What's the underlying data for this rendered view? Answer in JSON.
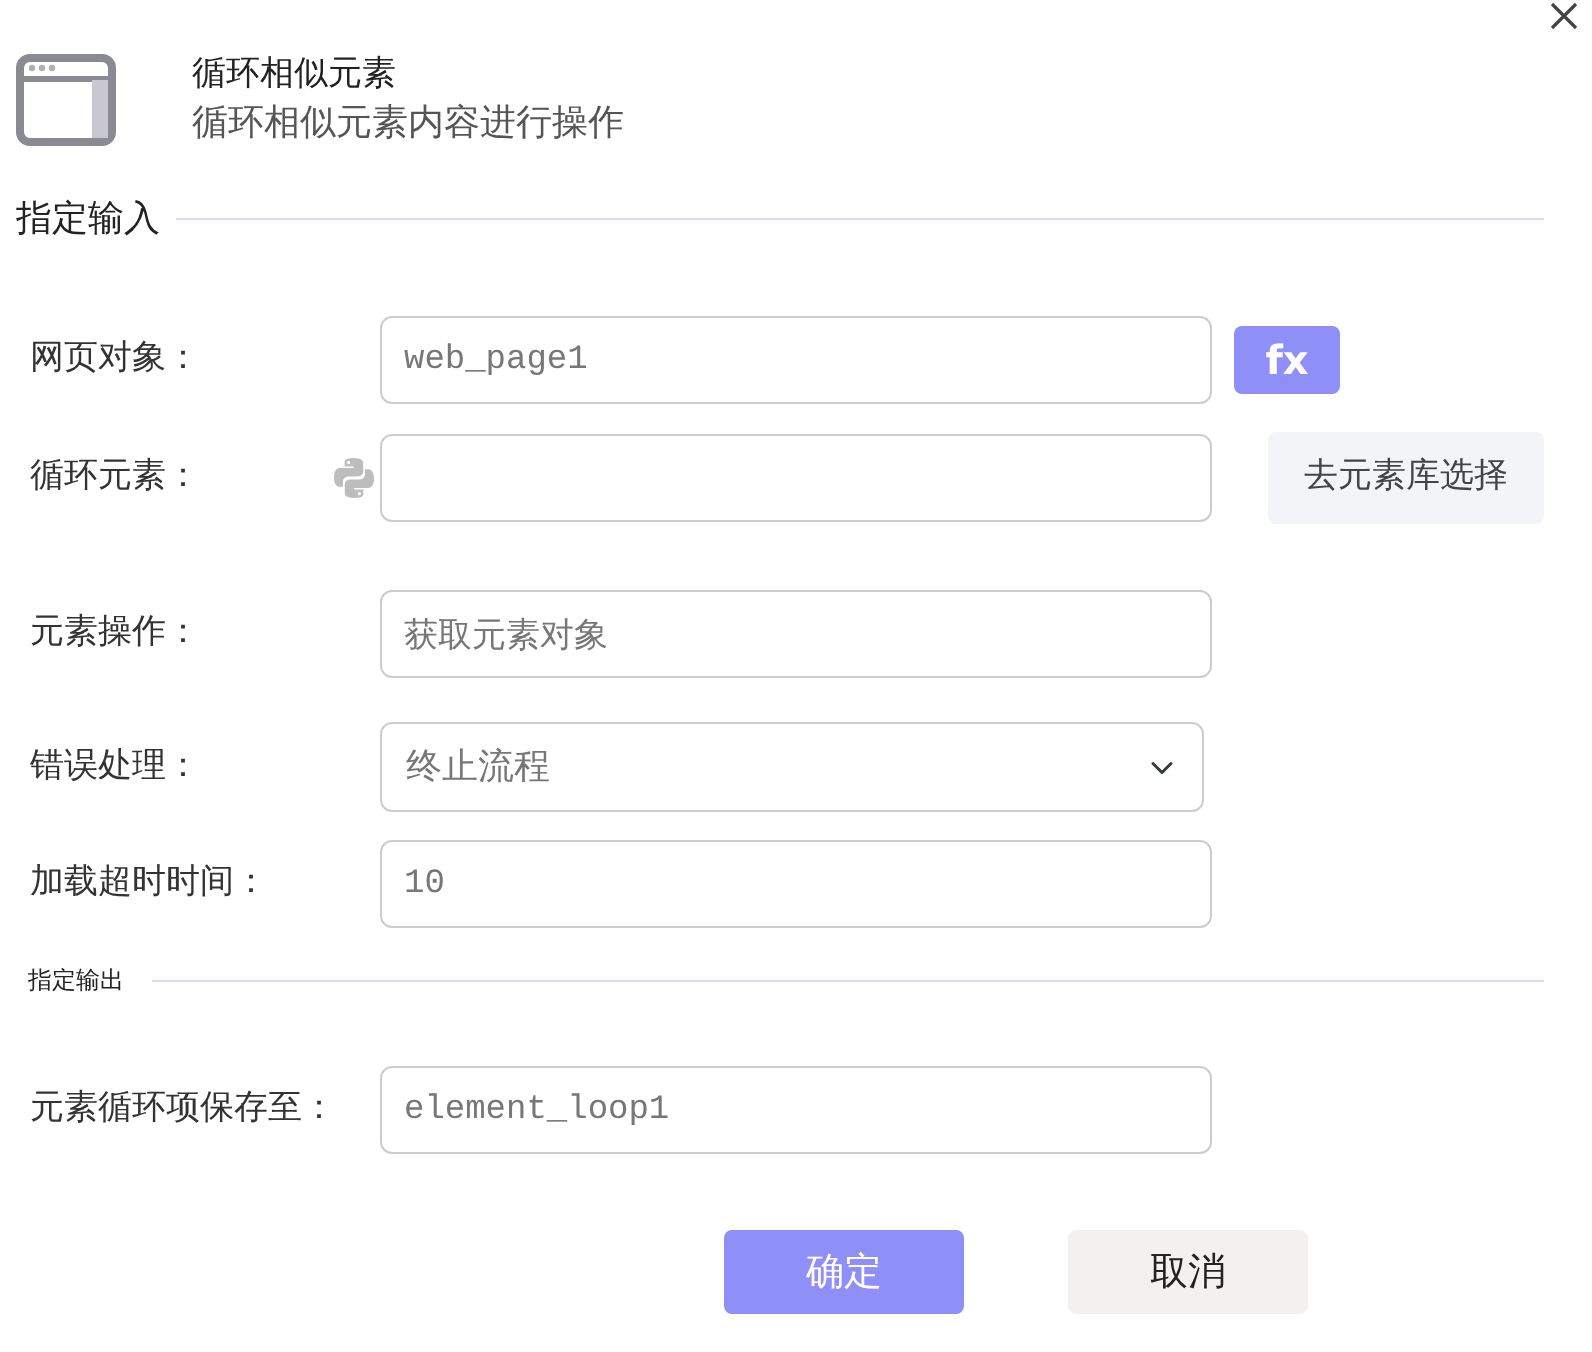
{
  "header": {
    "title": "循环相似元素",
    "subtitle": "循环相似元素内容进行操作"
  },
  "sections": [
    {
      "title": "指定输入",
      "kind": "major",
      "fields": [
        {
          "label": "网页对象：",
          "kind": "input",
          "value": "web_page1",
          "side_button": {
            "label": "fx",
            "kind": "fx"
          }
        },
        {
          "label": "循环元素：",
          "kind": "input",
          "python_icon": true,
          "side_button": {
            "label": "去元素库选择",
            "kind": "library"
          }
        },
        {
          "label": "元素操作：",
          "kind": "input",
          "value": "获取元素对象"
        },
        {
          "label": "错误处理：",
          "kind": "select",
          "value": "终止流程"
        },
        {
          "label": "加载超时时间：",
          "kind": "input",
          "value": "10"
        }
      ]
    },
    {
      "title": "指定输出",
      "kind": "minor",
      "fields": [
        {
          "label": "元素循环项保存至：",
          "kind": "input",
          "value": "element_loop1"
        }
      ]
    }
  ],
  "buttons": [
    {
      "label": "确定",
      "kind": "primary"
    },
    {
      "label": "取消",
      "kind": "secondary"
    }
  ]
}
